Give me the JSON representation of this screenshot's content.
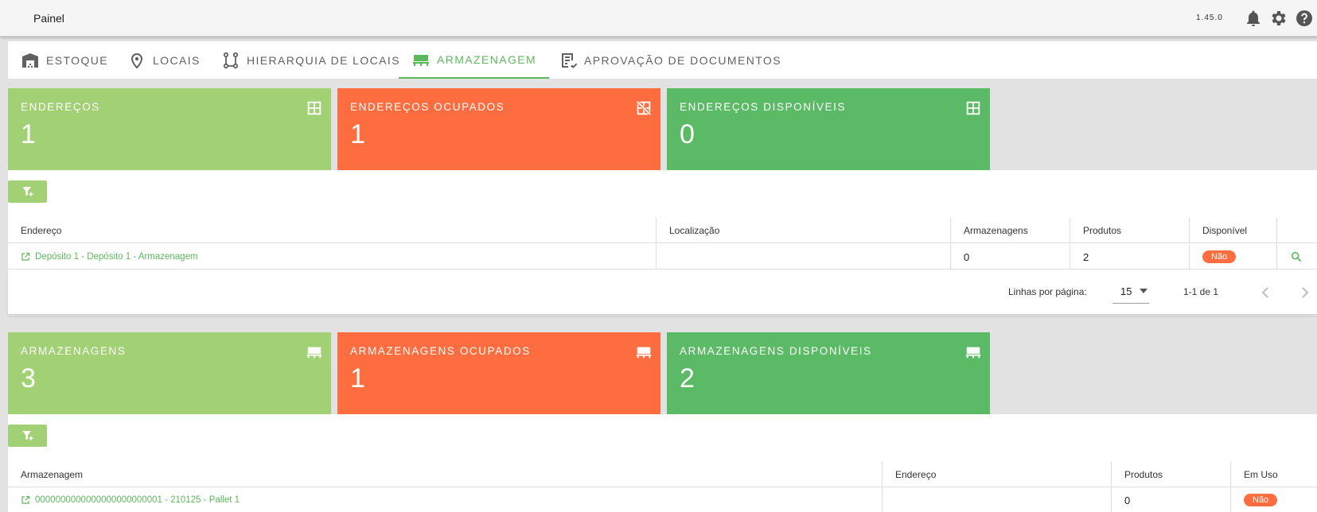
{
  "header": {
    "title": "Painel",
    "version": "1.45.0"
  },
  "tabs": [
    {
      "label": "ESTOQUE",
      "icon": "warehouse-icon"
    },
    {
      "label": "LOCAIS",
      "icon": "location-pin-icon"
    },
    {
      "label": "HIERARQUIA DE LOCAIS",
      "icon": "hierarchy-icon"
    },
    {
      "label": "ARMAZENAGEM",
      "icon": "storage-icon",
      "active": true
    },
    {
      "label": "APROVAÇÃO DE DOCUMENTOS",
      "icon": "document-approval-icon"
    }
  ],
  "enderecos_cards": [
    {
      "label": "ENDEREÇOS",
      "value": "1",
      "color": "#a2d175",
      "icon": "grid-icon"
    },
    {
      "label": "ENDEREÇOS OCUPADOS",
      "value": "1",
      "color": "#fd6d3f",
      "icon": "grid-off-icon"
    },
    {
      "label": "ENDEREÇOS DISPONÍVEIS",
      "value": "0",
      "color": "#5bba65",
      "icon": "grid-icon"
    }
  ],
  "enderecos_table": {
    "columns": [
      "Endereço",
      "Localização",
      "Armazenagens",
      "Produtos",
      "Disponível"
    ],
    "rows": [
      {
        "endereco": "Depósito 1 - Depósito 1 - Armazenagem",
        "localizacao": "",
        "armazenagens": "0",
        "produtos": "2",
        "disponivel": "Não"
      }
    ],
    "pagination": {
      "rows_label": "Linhas por página:",
      "rows_per_page": "15",
      "range": "1-1 de 1"
    }
  },
  "armazenagens_cards": [
    {
      "label": "ARMAZENAGENS",
      "value": "3",
      "color": "#a2d175",
      "icon": "storage-icon"
    },
    {
      "label": "ARMAZENAGENS OCUPADOS",
      "value": "1",
      "color": "#fd6d3f",
      "icon": "storage-icon"
    },
    {
      "label": "ARMAZENAGENS DISPONÍVEIS",
      "value": "2",
      "color": "#5bba65",
      "icon": "storage-icon"
    }
  ],
  "armazenagens_table": {
    "columns": [
      "Armazenagem",
      "Endereço",
      "Produtos",
      "Em Uso"
    ],
    "rows": [
      {
        "armazenagem": "0000000000000000000000001 - 210125 - Pallet 1",
        "endereco": "",
        "produtos": "0",
        "em_uso": "Não"
      }
    ]
  }
}
